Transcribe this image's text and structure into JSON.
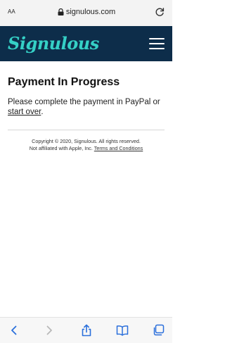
{
  "browser": {
    "text_size_label": "AA",
    "url": "signulous.com",
    "icons": [
      "lock-icon",
      "reload-icon"
    ]
  },
  "header": {
    "logo_text": "Signulous",
    "menu_icon": "hamburger-icon",
    "background": "#0d2d4a",
    "logo_color": "#35d0c6"
  },
  "main": {
    "title": "Payment In Progress",
    "message_prefix": "Please complete the payment in PayPal or ",
    "start_over_link": "start over",
    "message_suffix": "."
  },
  "footer": {
    "copyright": "Copyright © 2020, Signulous. All rights reserved.",
    "affiliation": "Not affiliated with Apple, Inc.",
    "terms_link": "Terms and Conditions"
  },
  "toolbar": {
    "icons": [
      "back-icon",
      "forward-icon",
      "share-icon",
      "bookmarks-icon",
      "tabs-icon"
    ]
  }
}
